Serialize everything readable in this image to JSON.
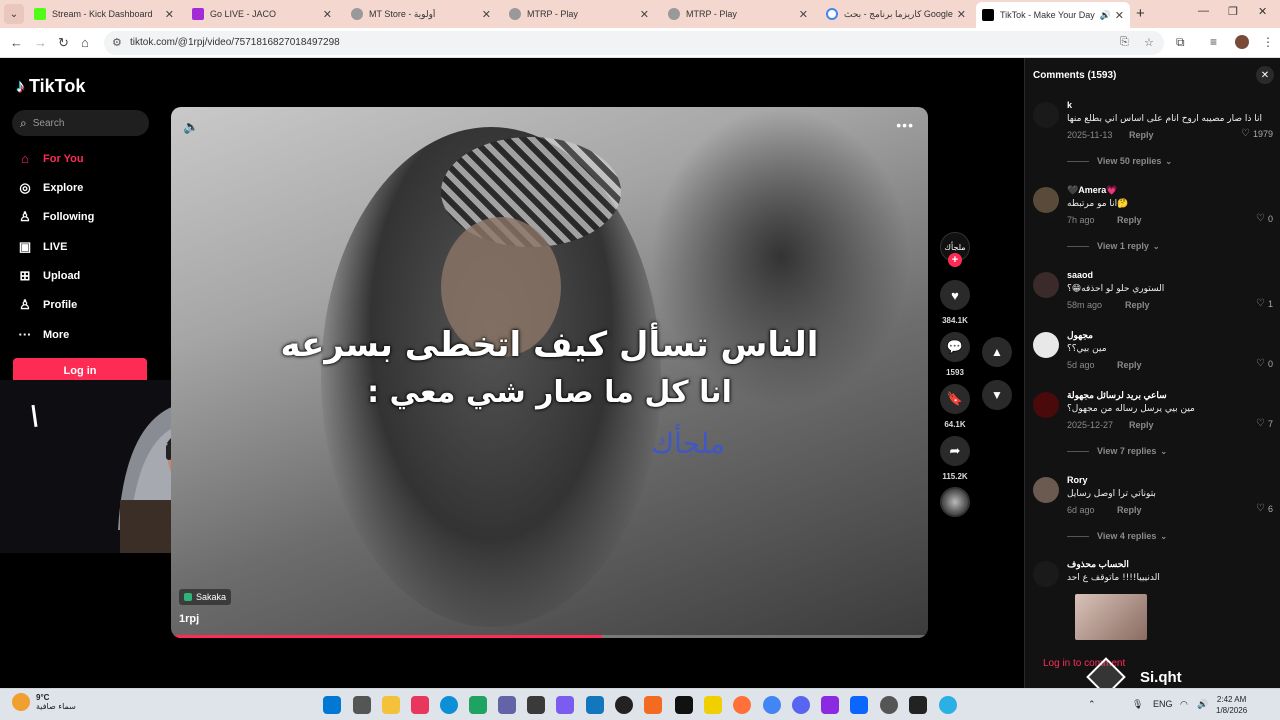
{
  "browser": {
    "tabs": [
      {
        "title": "Stream - Kick Dashboard",
        "favicon_color": "#53fc18"
      },
      {
        "title": "Go LIVE - JACO",
        "favicon_color": "#a42cd6"
      },
      {
        "title": "MT Store - أولوية",
        "favicon_color": "#999999"
      },
      {
        "title": "MTRP - Play",
        "favicon_color": "#999999"
      },
      {
        "title": "MTRP - Play",
        "favicon_color": "#999999"
      },
      {
        "title": "كاريزما برنامج - بحث Google",
        "favicon_color": "#4285f4"
      },
      {
        "title": "TikTok - Make Your Day",
        "favicon_color": "#000000"
      }
    ],
    "url": "tiktok.com/@1rpj/video/7571816827018497298"
  },
  "sidebar": {
    "logo": "TikTok",
    "search_placeholder": "Search",
    "nav": [
      {
        "label": "For You",
        "icon": "home-icon"
      },
      {
        "label": "Explore",
        "icon": "compass-icon"
      },
      {
        "label": "Following",
        "icon": "user-icon"
      },
      {
        "label": "LIVE",
        "icon": "live-icon"
      },
      {
        "label": "Upload",
        "icon": "plus-box-icon"
      },
      {
        "label": "Profile",
        "icon": "profile-icon"
      },
      {
        "label": "More",
        "icon": "more-icon"
      }
    ],
    "login_label": "Log in"
  },
  "video": {
    "caption_line1": "الناس تسأل كيف اتخطى بسرعه",
    "caption_line2": "انا كل ما صار شي معي :",
    "watermark": "ملجأك",
    "location": "Sakaka",
    "username": "1rpj",
    "progress": 0.57
  },
  "actions": {
    "avatar_label": "ملجأك",
    "likes": "384.1K",
    "comments": "1593",
    "saves": "64.1K",
    "shares": "115.2K"
  },
  "comments_panel": {
    "title": "Comments (1593)",
    "login_prompt": "Log in to comment",
    "items": [
      {
        "author": "k",
        "text": "انا ذا صار مصيبه اروح انام على اساس اني بطلع منها",
        "date": "2025-11-13",
        "likes": "1979",
        "replies": "View 50 replies",
        "avatar_color": "#1a1a1a"
      },
      {
        "author": "🖤Amera💗",
        "text": "انا مو مرتبطه🤔",
        "date": "7h ago",
        "likes": "0",
        "replies": "View 1 reply",
        "avatar_color": "#5a4a3a"
      },
      {
        "author": "saaod",
        "text": "الستوري حلو لو احذفه😁؟",
        "date": "58m ago",
        "likes": "1",
        "replies": "",
        "avatar_color": "#3a2a2a"
      },
      {
        "author": "مجهول",
        "text": "مين بيي؟؟",
        "date": "5d ago",
        "likes": "0",
        "replies": "",
        "avatar_color": "#e8e8e8"
      },
      {
        "author": "ساعي بريد لرسائل مجهولة",
        "text": "مين بيي يرسل رساله من مجهول؟",
        "date": "2025-12-27",
        "likes": "7",
        "replies": "View 7 replies",
        "avatar_color": "#4a0a0a"
      },
      {
        "author": "Rory",
        "text": "بتوناتي ترا اوصل رسايل",
        "date": "6d ago",
        "likes": "6",
        "replies": "View 4 replies",
        "avatar_color": "#6a5a50"
      },
      {
        "author": "الحساب محذوف",
        "text": "الدنيييا!!!! ماتوقف ع احد",
        "date": "",
        "likes": "",
        "replies": "",
        "avatar_color": "#1a1a1a"
      }
    ],
    "reply_label": "Reply"
  },
  "overlay": {
    "brand": "Si.qht"
  },
  "taskbar": {
    "temp": "9°C",
    "weather_desc": "سماء صافية",
    "lang": "ENG",
    "time": "2:42 AM",
    "date": "1/8/2026"
  },
  "colors": {
    "accent": "#fe2c55"
  }
}
